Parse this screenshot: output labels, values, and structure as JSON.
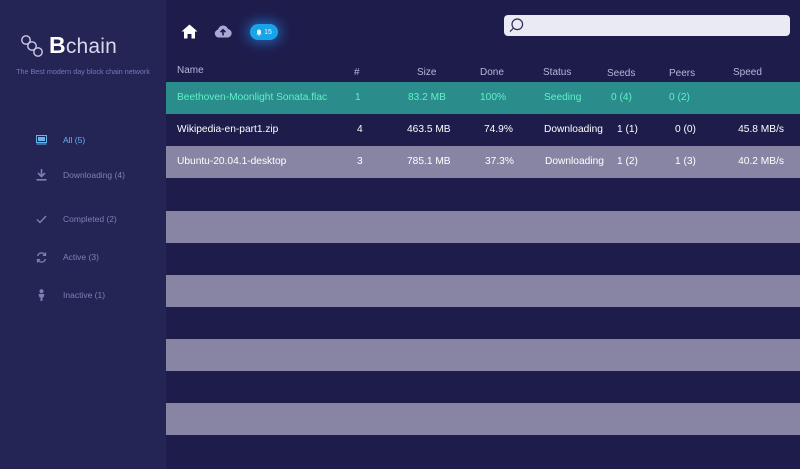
{
  "app": {
    "logo_bold": "B",
    "logo_rest": "chain",
    "tagline": "The Best modern day block chain network"
  },
  "sidebar": {
    "items": [
      {
        "label": "All (5)",
        "icon": "monitor-icon"
      },
      {
        "label": "Downloading (4)",
        "icon": "download-icon"
      },
      {
        "label": "Completed (2)",
        "icon": "check-icon"
      },
      {
        "label": "Active (3)",
        "icon": "refresh-icon"
      },
      {
        "label": "Inactive (1)",
        "icon": "person-icon"
      }
    ]
  },
  "toolbar": {
    "badge_count": "15"
  },
  "search": {
    "placeholder": "",
    "value": ""
  },
  "table": {
    "headers": {
      "name": "Name",
      "num": "#",
      "size": "Size",
      "done": "Done",
      "status": "Status",
      "seeds": "Seeds",
      "peers": "Peers",
      "speed": "Speed"
    },
    "rows": [
      {
        "name": "Beethoven-Moonlight Sonata.flac",
        "num": "1",
        "size": "83.2 MB",
        "done": "100%",
        "status": "Seeding",
        "seeds": "0 (4)",
        "peers": "0 (2)",
        "speed": ""
      },
      {
        "name": "Wikipedia-en-part1.zip",
        "num": "4",
        "size": "463.5 MB",
        "done": "74.9%",
        "status": "Downloading",
        "seeds": "1 (1)",
        "peers": "0 (0)",
        "speed": "45.8 MB/s"
      },
      {
        "name": "Ubuntu-20.04.1-desktop",
        "num": "3",
        "size": "785.1 MB",
        "done": "37.3%",
        "status": "Downloading",
        "seeds": "1 (2)",
        "peers": "1 (3)",
        "speed": "40.2 MB/s"
      }
    ]
  },
  "colors": {
    "background": "#1e1c4b",
    "sidebar": "#242455",
    "selected_row": "#2b8c8c",
    "selected_text": "#5ff1c8",
    "stripe": "#8785a3",
    "accent": "#1aa3e8",
    "nav_active": "#66b3ee"
  }
}
